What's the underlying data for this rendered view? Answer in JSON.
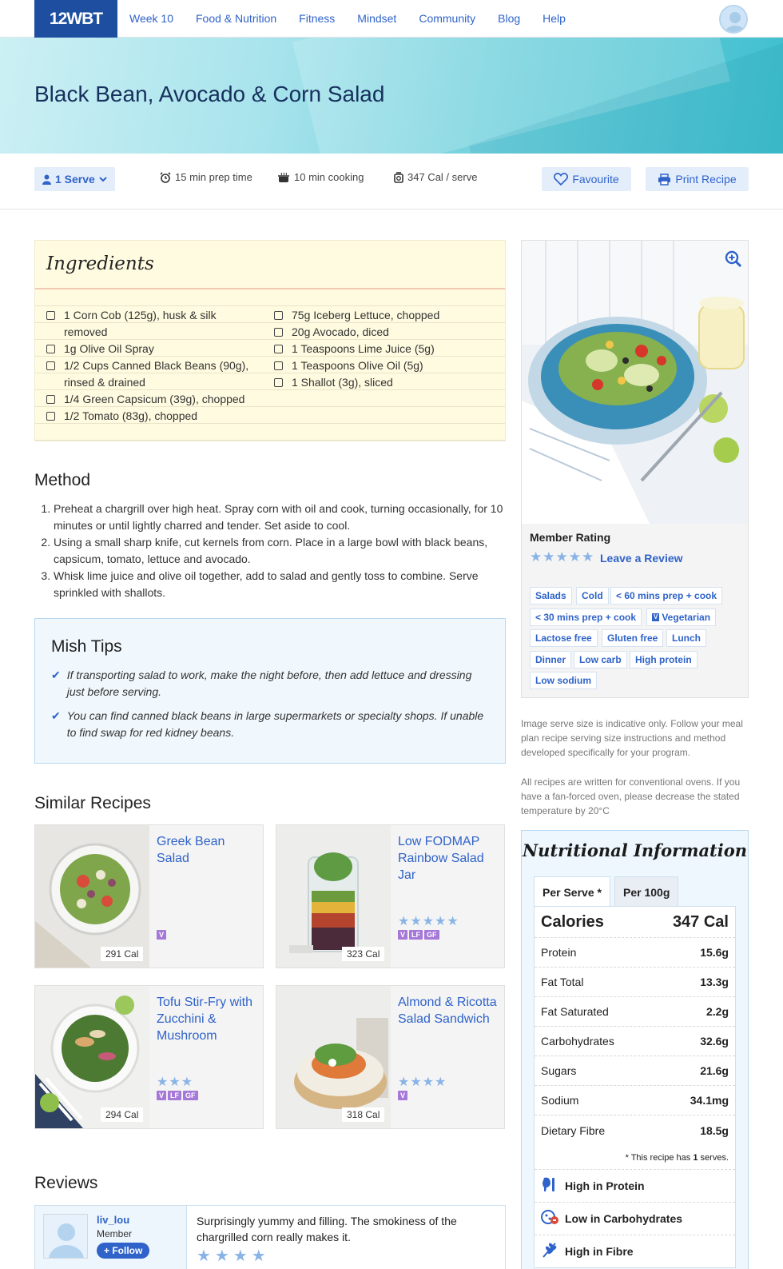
{
  "nav": {
    "logo": "12WBT",
    "links": [
      "Week 10",
      "Food & Nutrition",
      "Fitness",
      "Mindset",
      "Community",
      "Blog",
      "Help"
    ]
  },
  "recipe": {
    "title": "Black Bean, Avocado & Corn Salad",
    "serves_label": "1 Serve",
    "prep_time": "15 min prep time",
    "cooking_time": "10 min cooking",
    "calories": "347 Cal / serve",
    "favourite_label": "Favourite",
    "print_label": "Print Recipe"
  },
  "ingredients": {
    "title": "Ingredients",
    "left": [
      [
        "1 Corn Cob (125g), husk & silk",
        "removed"
      ],
      [
        "1g Olive Oil Spray"
      ],
      [
        "1/2 Cups Canned Black Beans (90g),",
        "rinsed & drained"
      ],
      [
        "1/4 Green Capsicum (39g), chopped"
      ],
      [
        "1/2 Tomato (83g), chopped"
      ]
    ],
    "right": [
      "75g Iceberg Lettuce, chopped",
      "20g Avocado, diced",
      "1 Teaspoons Lime Juice (5g)",
      "1 Teaspoons Olive Oil (5g)",
      "1 Shallot (3g), sliced"
    ]
  },
  "method": {
    "title": "Method",
    "steps": [
      "Preheat a chargrill over high heat. Spray corn with oil and cook, turning occasionally, for 10 minutes or until lightly charred and tender. Set aside to cool.",
      "Using a small sharp knife, cut kernels from corn. Place in a large bowl with black beans, capsicum, tomato, lettuce and avocado.",
      "Whisk lime juice and olive oil together, add to salad and gently toss to combine. Serve sprinkled with shallots."
    ]
  },
  "tips": {
    "title": "Mish Tips",
    "items": [
      "If transporting salad to work, make the night before, then add lettuce and dressing just before serving.",
      "You can find canned black beans in large supermarkets or specialty shops. If unable to find swap for red kidney beans."
    ]
  },
  "similar": {
    "title": "Similar Recipes",
    "cards": [
      {
        "name": "Greek Bean Salad",
        "cal": "291 Cal",
        "rating": 0,
        "badges": [
          "V"
        ]
      },
      {
        "name": "Low FODMAP Rainbow Salad Jar",
        "cal": "323 Cal",
        "rating": 5,
        "badges": [
          "V",
          "LF",
          "GF"
        ]
      },
      {
        "name": "Tofu Stir-Fry with Zucchini & Mushroom",
        "cal": "294 Cal",
        "rating": 3,
        "badges": [
          "V",
          "LF",
          "GF"
        ]
      },
      {
        "name": "Almond & Ricotta Salad Sandwich",
        "cal": "318 Cal",
        "rating": 4,
        "badges": [
          "V"
        ]
      }
    ]
  },
  "reviews": {
    "title": "Reviews",
    "items": [
      {
        "user": "liv_lou",
        "role": "Member",
        "follow": "+ Follow",
        "text": "Surprisingly yummy and filling. The smokiness of the chargrilled corn really makes it.",
        "rating": 4
      }
    ]
  },
  "sidebar": {
    "member_rating_label": "Member Rating",
    "member_rating": 4,
    "leave_review": "Leave a Review",
    "tags": [
      "Salads",
      "Cold",
      "< 60 mins prep + cook",
      "< 30 mins prep + cook",
      "Vegetarian",
      "Lactose free",
      "Gluten free",
      "Lunch",
      "Dinner",
      "Low carb",
      "High protein",
      "Low sodium"
    ],
    "note1": "Image serve size is indicative only. Follow your meal plan recipe serving size instructions and method developed specifically for your program.",
    "note2": "All recipes are written for conventional ovens. If you have a fan-forced oven, please decrease the stated temperature by 20°C"
  },
  "nutrition": {
    "title": "Nutritional Information",
    "tabs": [
      "Per Serve *",
      "Per 100g"
    ],
    "calories_label": "Calories",
    "calories_value": "347 Cal",
    "rows": [
      {
        "label": "Protein",
        "value": "15.6g"
      },
      {
        "label": "Fat Total",
        "value": "13.3g"
      },
      {
        "label": "Fat Saturated",
        "value": "2.2g"
      },
      {
        "label": "Carbohydrates",
        "value": "32.6g"
      },
      {
        "label": "Sugars",
        "value": "21.6g"
      },
      {
        "label": "Sodium",
        "value": "34.1mg"
      },
      {
        "label": "Dietary Fibre",
        "value": "18.5g"
      }
    ],
    "footnote_prefix": "* This recipe has ",
    "footnote_count": "1",
    "footnote_suffix": " serves.",
    "highlights": [
      "High in Protein",
      "Low in Carbohydrates",
      "High in Fibre"
    ]
  },
  "colors": {
    "accent": "#2f63c9",
    "logo_bg": "#1d4ea0",
    "star": "#8ab4e6",
    "badge": "#a678d8"
  }
}
